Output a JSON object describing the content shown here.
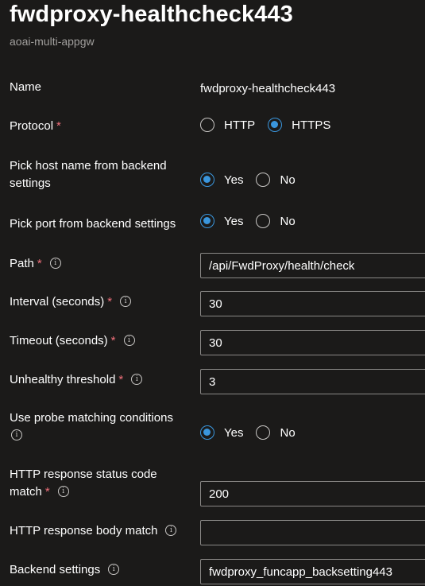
{
  "header": {
    "title": "fwdproxy-healthcheck443",
    "subtitle": "aoai-multi-appgw"
  },
  "form": {
    "name": {
      "label": "Name",
      "value": "fwdproxy-healthcheck443"
    },
    "protocol": {
      "label": "Protocol",
      "required": "*",
      "options": [
        "HTTP",
        "HTTPS"
      ],
      "selected": "HTTPS"
    },
    "pick_host": {
      "label_line1": "Pick host name from backend",
      "label_line2": "settings",
      "options": [
        "Yes",
        "No"
      ],
      "selected": "Yes"
    },
    "pick_port": {
      "label": "Pick port from backend settings",
      "options": [
        "Yes",
        "No"
      ],
      "selected": "Yes"
    },
    "path": {
      "label": "Path",
      "required": "*",
      "info": "i",
      "value": "/api/FwdProxy/health/check"
    },
    "interval": {
      "label": "Interval (seconds)",
      "required": "*",
      "info": "i",
      "value": "30"
    },
    "timeout": {
      "label": "Timeout (seconds)",
      "required": "*",
      "info": "i",
      "value": "30"
    },
    "unhealthy": {
      "label": "Unhealthy threshold",
      "required": "*",
      "info": "i",
      "value": "3"
    },
    "probe_matching": {
      "label": "Use probe matching conditions",
      "info": "i",
      "options": [
        "Yes",
        "No"
      ],
      "selected": "Yes"
    },
    "status_code": {
      "label_line1": "HTTP response status code",
      "label_line2": "match",
      "required": "*",
      "info": "i",
      "value": "200"
    },
    "body_match": {
      "label": "HTTP response body match",
      "info": "i",
      "value": ""
    },
    "backend_settings": {
      "label": "Backend settings",
      "info": "i",
      "value": "fwdproxy_funcapp_backsetting443"
    }
  },
  "colors": {
    "background": "#1b1a19",
    "accent": "#3a96dd",
    "required": "#f1707b",
    "border": "#8a8886"
  }
}
